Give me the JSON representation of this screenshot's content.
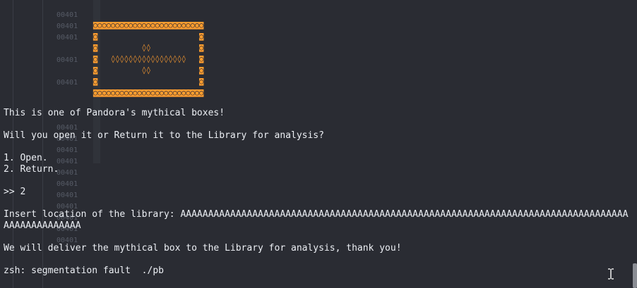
{
  "background_addresses": [
    "00401",
    "00401",
    "00401",
    "00401",
    "00401",
    "00401",
    "00401",
    "00401",
    "00401",
    "00401",
    "00401",
    "00401",
    "00401",
    "00401",
    "00401",
    "00401"
  ],
  "box_art": [
    "◙◙◙◙◙◙◙◙◙◙◙◙◙◙◙◙◙◙◙◙◙◙◙◙◙",
    "◙                       ◙",
    "◙          ◊◊           ◙",
    "◙   ◊◊◊◊◊◊◊◊◊◊◊◊◊◊◊◊◊   ◙",
    "◙          ◊◊           ◙",
    "◙                       ◙",
    "◙◙◙◙◙◙◙◙◙◙◙◙◙◙◙◙◙◙◙◙◙◙◙◙◙"
  ],
  "terminal": {
    "intro": "This is one of Pandora's mythical boxes!",
    "question": "Will you open it or Return it to the Library for analysis?",
    "option1": "1. Open.",
    "option2": "2. Return.",
    "prompt": ">> 2",
    "insert_line1": "Insert location of the library: AAAAAAAAAAAAAAAAAAAAAAAAAAAAAAAAAAAAAAAAAAAAAAAAAAAAAAAAAAAAAAAAAAAAAAAAAAAAAAAAAAAAAAAAAAAAAAAAAAAAAAAAAAAAA",
    "insert_line2": "AAAAAAAAAAAAAA",
    "deliver": "We will deliver the mythical box to the Library for analysis, thank you!",
    "segfault": "zsh: segmentation fault  ./pb"
  },
  "colors": {
    "background": "#2a2c33",
    "text": "#eceff4",
    "box_art": "#ff9d2f",
    "faded_address": "#565b66"
  },
  "icons": {
    "cursor": "text-cursor-icon"
  }
}
